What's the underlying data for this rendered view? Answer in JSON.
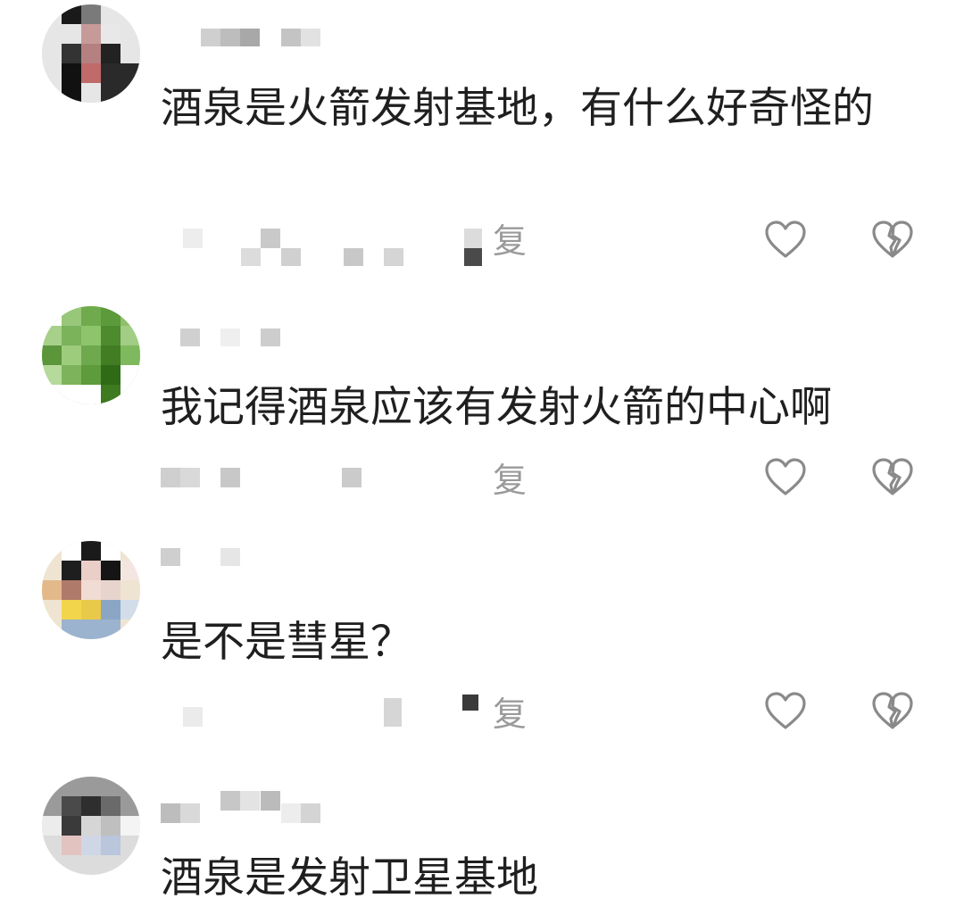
{
  "comments": [
    {
      "text": "酒泉是火箭发射基地，有什么好奇怪的",
      "reply_label": "复"
    },
    {
      "text": "我记得酒泉应该有发射火箭的中心啊",
      "reply_label": "复"
    },
    {
      "text": "是不是彗星？",
      "reply_label": "复"
    },
    {
      "text": "酒泉是发射卫星基地"
    }
  ],
  "icons": {
    "like": "heart-icon",
    "dislike": "broken-heart-icon"
  }
}
